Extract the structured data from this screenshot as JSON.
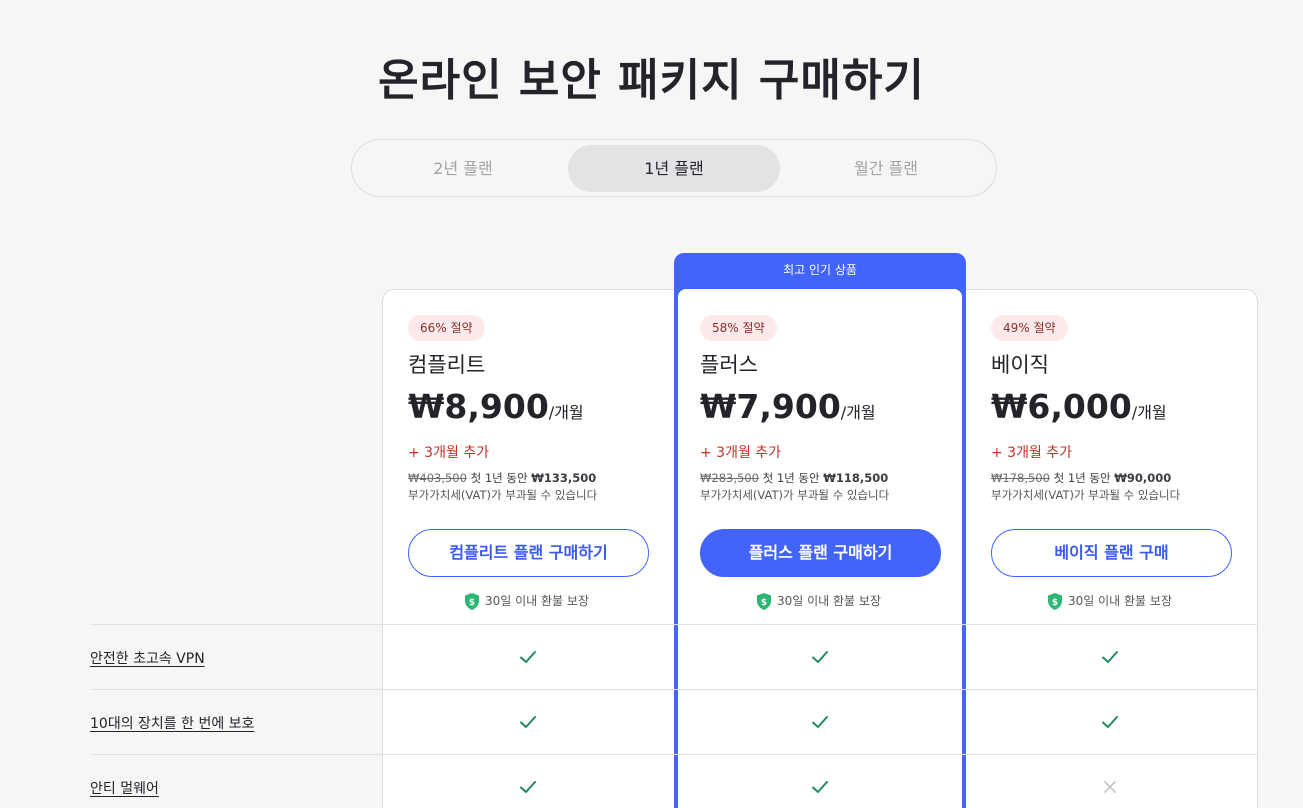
{
  "page_title": "온라인 보안 패키지 구매하기",
  "billing_toggle": {
    "options": [
      "2년 플랜",
      "1년 플랜",
      "월간 플랜"
    ],
    "selected": "1년 플랜"
  },
  "featured_banner": "최고 인기 상품",
  "plans": [
    {
      "badge": "66% 절약",
      "name": "컴플리트",
      "price": "₩8,900",
      "per": "/개월",
      "bonus": "+ 3개월 추가",
      "original_price": "₩403,500",
      "first_year_text": " 첫 1년 동안 ",
      "first_year_price": "₩133,500",
      "vat_note": "부가가치세(VAT)가 부과될 수 있습니다",
      "cta": "컴플리트 플랜 구매하기",
      "guarantee": "30일 이내 환불 보장"
    },
    {
      "badge": "58% 절약",
      "name": "플러스",
      "price": "₩7,900",
      "per": "/개월",
      "bonus": "+ 3개월 추가",
      "original_price": "₩283,500",
      "first_year_text": " 첫 1년 동안 ",
      "first_year_price": "₩118,500",
      "vat_note": "부가가치세(VAT)가 부과될 수 있습니다",
      "cta": "플러스 플랜 구매하기",
      "guarantee": "30일 이내 환불 보장"
    },
    {
      "badge": "49% 절약",
      "name": "베이직",
      "price": "₩6,000",
      "per": "/개월",
      "bonus": "+ 3개월 추가",
      "original_price": "₩178,500",
      "first_year_text": " 첫 1년 동안 ",
      "first_year_price": "₩90,000",
      "vat_note": "부가가치세(VAT)가 부과될 수 있습니다",
      "cta": "베이직 플랜 구매",
      "guarantee": "30일 이내 환불 보장"
    }
  ],
  "features": [
    {
      "label": "안전한 초고속 VPN",
      "included": [
        true,
        true,
        true
      ]
    },
    {
      "label": "10대의 장치를 한 번에 보호",
      "included": [
        true,
        true,
        true
      ]
    },
    {
      "label": "안티 멀웨어",
      "included": [
        true,
        true,
        false
      ]
    }
  ],
  "colors": {
    "accent": "#4264fb",
    "check": "#1f8a5b",
    "cross": "#c8c8cc",
    "bonus": "#c0322b",
    "badge_bg": "#fde9e9",
    "shield": "#2bb673"
  }
}
